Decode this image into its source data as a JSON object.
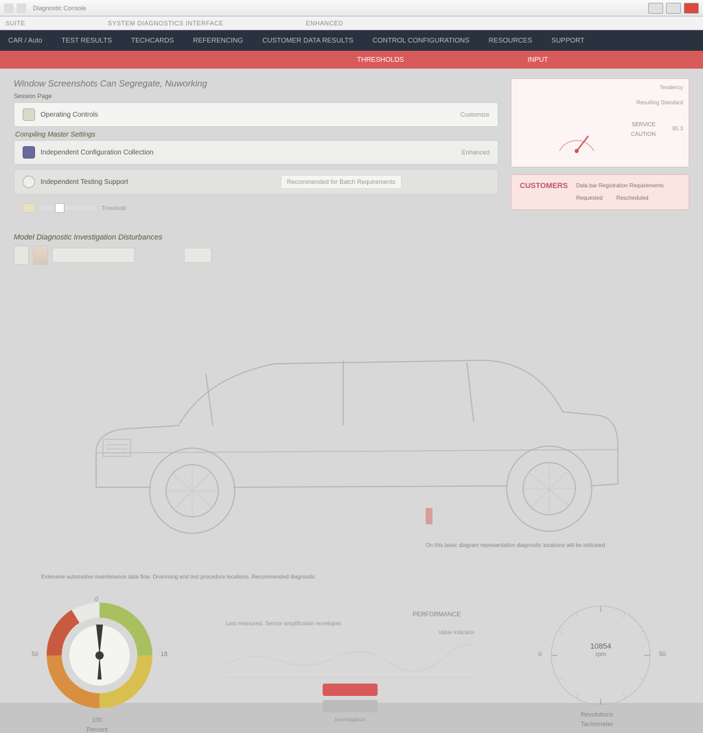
{
  "titlebar": {
    "app": "Diagnostic Console"
  },
  "toolbar": {
    "a": "SUITE",
    "b": "SYSTEM DIAGNOSTICS INTERFACE",
    "c": "ENHANCED"
  },
  "nav": {
    "items": [
      "CAR / Auto",
      "TEST RESULTS",
      "TECHCARDS",
      "REFERENCING",
      "CUSTOMER DATA RESULTS",
      "CONTROL CONFIGURATIONS",
      "RESOURCES",
      "SUPPORT"
    ]
  },
  "subnav": {
    "a": "THRESHOLDS",
    "b": "INPUT"
  },
  "page": {
    "title": "Window Screenshots Can Segregate, Nuworking",
    "section_label": "Session Page",
    "cards": [
      {
        "icon": "folder",
        "title": "Operating Controls",
        "tag": "Customize"
      },
      {
        "icon": "shield",
        "title": "Compiling Master Settings",
        "sub": "Independent Configuration Collection",
        "tag": "Enhanced"
      },
      {
        "icon": "clock",
        "title": "Independent Testing Support",
        "extra": "Recommended for Batch Requirements",
        "tag": ""
      }
    ],
    "slider_label": "Threshold"
  },
  "gauge_panel": {
    "labels": {
      "top": "",
      "right_top": "Tendency",
      "right_mid": "Resulting Standard",
      "side_a": "SERVICE",
      "side_b": "CAUTION",
      "val": "85.3"
    }
  },
  "alert": {
    "title": "CUSTOMERS",
    "line1": "Data bar Registration Requirements",
    "line2_a": "Requested",
    "line2_b": "Rescheduled"
  },
  "section2": {
    "title": "Model Diagnostic Investigation Disturbances"
  },
  "captions": {
    "a": "On this basic diagram representation diagnostic locations will be indicated",
    "b": "Extensive automotive maintenance data flow. Drumming and test procedure locations. Recommended diagnostic."
  },
  "bottom": {
    "gauge": {
      "title": "",
      "top": "0",
      "left": "50",
      "right": "18",
      "bottom": "100",
      "sub": "Percent"
    },
    "chart": {
      "title": "PERFORMANCE",
      "line_label": "Last measured. Sensor amplification envelopes",
      "sub": "Investigation",
      "side": "Value Indicator"
    },
    "dial": {
      "center_a": "10854",
      "center_b": "rpm",
      "left": "0",
      "right": "50",
      "bottom_a": "Revolutions",
      "bottom_b": "Tachometer"
    }
  }
}
